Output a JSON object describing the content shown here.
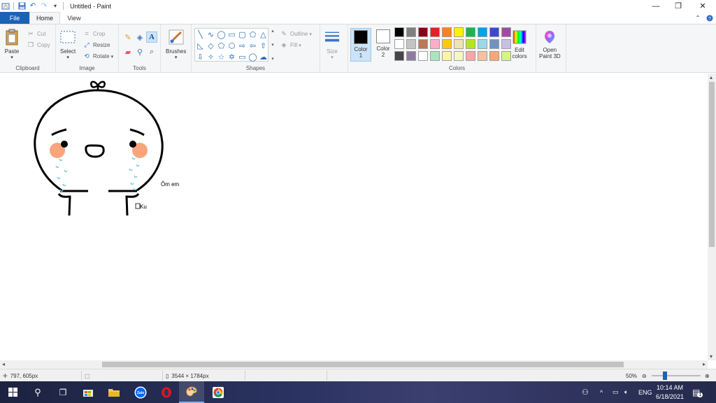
{
  "window": {
    "title": "Untitled - Paint",
    "minimize_glyph": "—",
    "restore_glyph": "❐",
    "close_glyph": "✕"
  },
  "quick_access": {
    "app_icon": "paint-app-icon",
    "save_icon": "save-icon",
    "undo_icon": "undo-icon",
    "redo_icon": "redo-icon",
    "customize_icon": "chevron-down-icon"
  },
  "tabs": {
    "file": "File",
    "home": "Home",
    "view": "View"
  },
  "ribbon": {
    "clipboard": {
      "paste": "Paste",
      "cut": "Cut",
      "copy": "Copy",
      "label": "Clipboard"
    },
    "image": {
      "select": "Select",
      "crop": "Crop",
      "resize": "Resize",
      "rotate": "Rotate",
      "label": "Image"
    },
    "tools": {
      "label": "Tools",
      "text_glyph": "A"
    },
    "brushes": {
      "label": "Brushes"
    },
    "shapes": {
      "outline": "Outline",
      "fill": "Fill",
      "label": "Shapes"
    },
    "size": {
      "label": "Size"
    },
    "colors": {
      "color1_line1": "Color",
      "color1_line2": "1",
      "color2_line1": "Color",
      "color2_line2": "2",
      "color1_value": "#000000",
      "color2_value": "#ffffff",
      "edit_line1": "Edit",
      "edit_line2": "colors",
      "paint3d_line1": "Open",
      "paint3d_line2": "Paint 3D",
      "label": "Colors",
      "palette": [
        "#000000",
        "#7f7f7f",
        "#880015",
        "#ed1c24",
        "#ff7f27",
        "#fff200",
        "#22b14c",
        "#00a2e8",
        "#3f48cc",
        "#a349a4",
        "#ffffff",
        "#c3c3c3",
        "#b97a57",
        "#ffaec9",
        "#ffc90e",
        "#efe4b0",
        "#b5e61d",
        "#99d9ea",
        "#7092be",
        "#c8bfe7",
        "#464646",
        "#8f7ba1",
        "#ffffff",
        "#a8e6c0",
        "#fbf3a5",
        "#f5f9c0",
        "#f9a6a6",
        "#f7c0a0",
        "#f8a874",
        "#d8f57c"
      ]
    }
  },
  "canvas": {
    "text_1": "Ôm em",
    "text_2": "Ku"
  },
  "status": {
    "cursor_pos": "797, 605px",
    "canvas_size": "3544 × 1784px",
    "zoom": "50%"
  },
  "taskbar": {
    "time": "10:14 AM",
    "date": "6/18/2021",
    "lang": "ENG",
    "notification_count": "1"
  }
}
